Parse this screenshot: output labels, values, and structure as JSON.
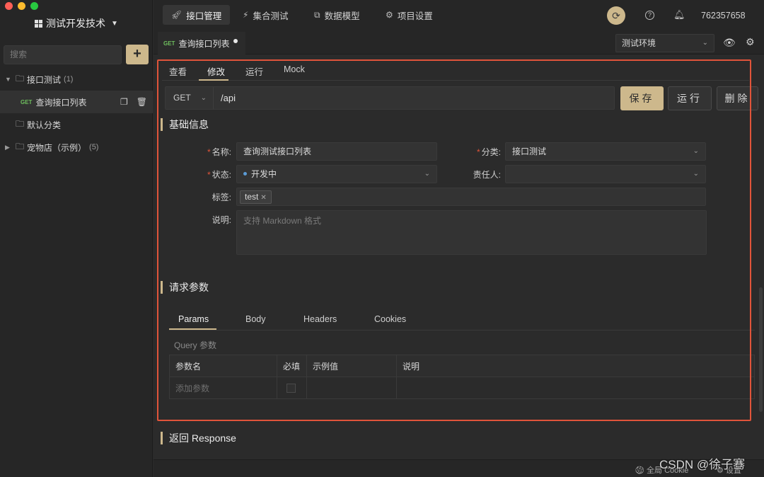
{
  "sidebar": {
    "project_name": "测试开发技术",
    "search_placeholder": "搜索",
    "add_label": "+",
    "tree": [
      {
        "label": "接口测试",
        "count": "(1)"
      },
      {
        "method": "GET",
        "label": "查询接口列表"
      },
      {
        "label": "默认分类"
      },
      {
        "label": "宠物店（示例）",
        "count": "(5)"
      }
    ]
  },
  "topnav": {
    "items": [
      {
        "icon": "rocket-icon",
        "label": "接口管理"
      },
      {
        "icon": "lightning-icon",
        "label": "集合测试"
      },
      {
        "icon": "cube-icon",
        "label": "数据模型"
      },
      {
        "icon": "gear-icon",
        "label": "项目设置"
      }
    ],
    "user_id": "762357658"
  },
  "tabbar": {
    "open_tab": {
      "method": "GET",
      "label": "查询接口列表"
    },
    "environment": "测试环境"
  },
  "editor": {
    "subtabs": [
      "查看",
      "修改",
      "运行",
      "Mock"
    ],
    "active_subtab": "修改",
    "method": "GET",
    "url": "/api",
    "save_label": "保存",
    "run_label": "运行",
    "delete_label": "删除"
  },
  "basic_info": {
    "title": "基础信息",
    "name_label": "名称:",
    "name_value": "查询测试接口列表",
    "category_label": "分类:",
    "category_value": "接口测试",
    "status_label": "状态:",
    "status_value": "开发中",
    "owner_label": "责任人:",
    "owner_value": "",
    "tags_label": "标签:",
    "tag": "test",
    "desc_label": "说明:",
    "desc_placeholder": "支持 Markdown 格式"
  },
  "request_params": {
    "title": "请求参数",
    "tabs": [
      "Params",
      "Body",
      "Headers",
      "Cookies"
    ],
    "active_tab": "Params",
    "query_label": "Query 参数",
    "columns": [
      "参数名",
      "必填",
      "示例值",
      "说明"
    ],
    "add_placeholder": "添加参数"
  },
  "response": {
    "title": "返回 Response"
  },
  "statusbar": {
    "cookie_label": "全局 Cookie",
    "right_label": "设置"
  },
  "watermark": "CSDN @徐子骞",
  "colors": {
    "accent": "#cdb88c",
    "highlight_border": "#e0543a",
    "get_method": "#6fbf5e",
    "background": "#2b2b2b"
  }
}
